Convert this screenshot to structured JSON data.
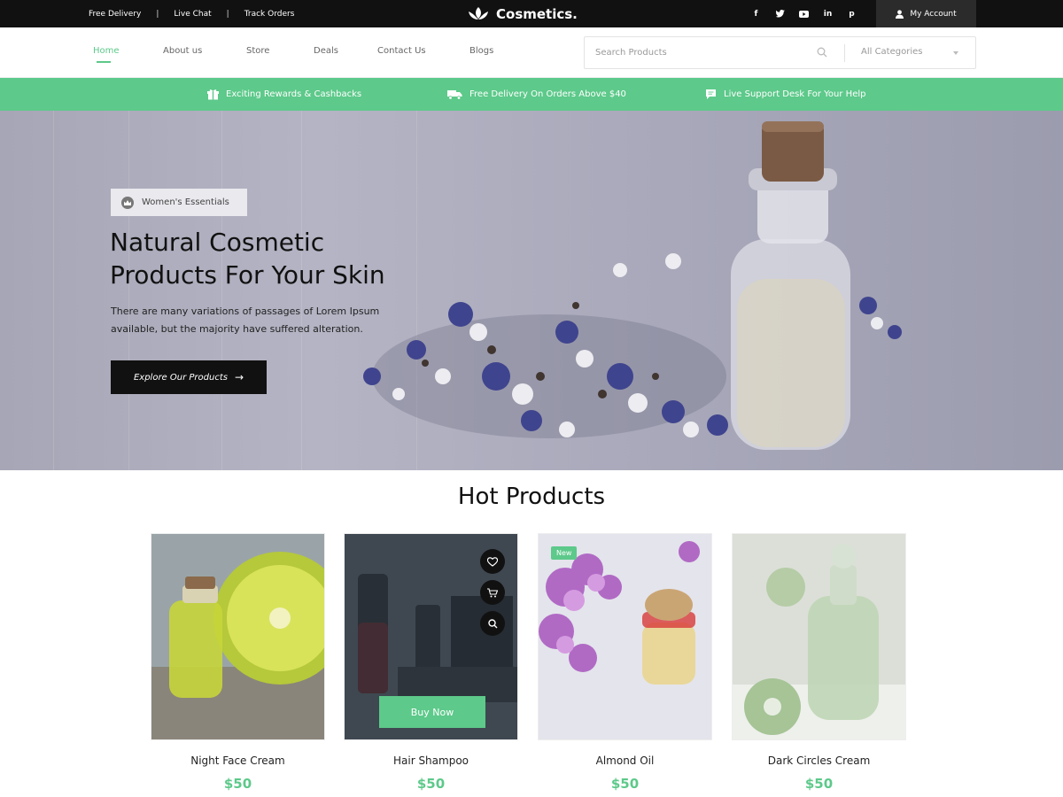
{
  "topbar": {
    "links": [
      "Free Delivery",
      "Live Chat",
      "Track Orders"
    ],
    "separator": "|",
    "logo_text": "Cosmetics.",
    "socials": [
      {
        "icon": "facebook-icon",
        "glyph": "f"
      },
      {
        "icon": "twitter-icon",
        "glyph": "t"
      },
      {
        "icon": "youtube-icon",
        "glyph": "▶"
      },
      {
        "icon": "linkedin-icon",
        "glyph": "in"
      },
      {
        "icon": "pinterest-icon",
        "glyph": "p"
      }
    ],
    "account_label": "My Account"
  },
  "nav": {
    "items": [
      "Home",
      "About us",
      "Store",
      "Deals",
      "Contact Us",
      "Blogs"
    ],
    "active": "Home",
    "search_placeholder": "Search Products",
    "category_label": "All Categories"
  },
  "promo": {
    "items": [
      "Exciting Rewards & Cashbacks",
      "Free Delivery On Orders Above $40",
      "Live Support Desk For Your Help"
    ]
  },
  "hero": {
    "badge": "Women's Essentials",
    "title_line1": "Natural Cosmetic",
    "title_line2": "Products For Your Skin",
    "desc_line1": "There are many variations of passages of Lorem Ipsum",
    "desc_line2": "available, but the majority have suffered alteration.",
    "cta_label": "Explore Our Products",
    "cta_arrow": "→"
  },
  "hot_products": {
    "title": "Hot Products",
    "items": [
      {
        "name": "Night Face Cream",
        "price": "$50"
      },
      {
        "name": "Hair Shampoo",
        "price": "$50",
        "buy_label": "Buy Now"
      },
      {
        "name": "Almond Oil",
        "price": "$50",
        "tag": "New"
      },
      {
        "name": "Dark Circles Cream",
        "price": "$50"
      }
    ]
  },
  "colors": {
    "accent": "#5dc98a",
    "topbar": "#111111",
    "account_bg": "#2b2b2b"
  }
}
